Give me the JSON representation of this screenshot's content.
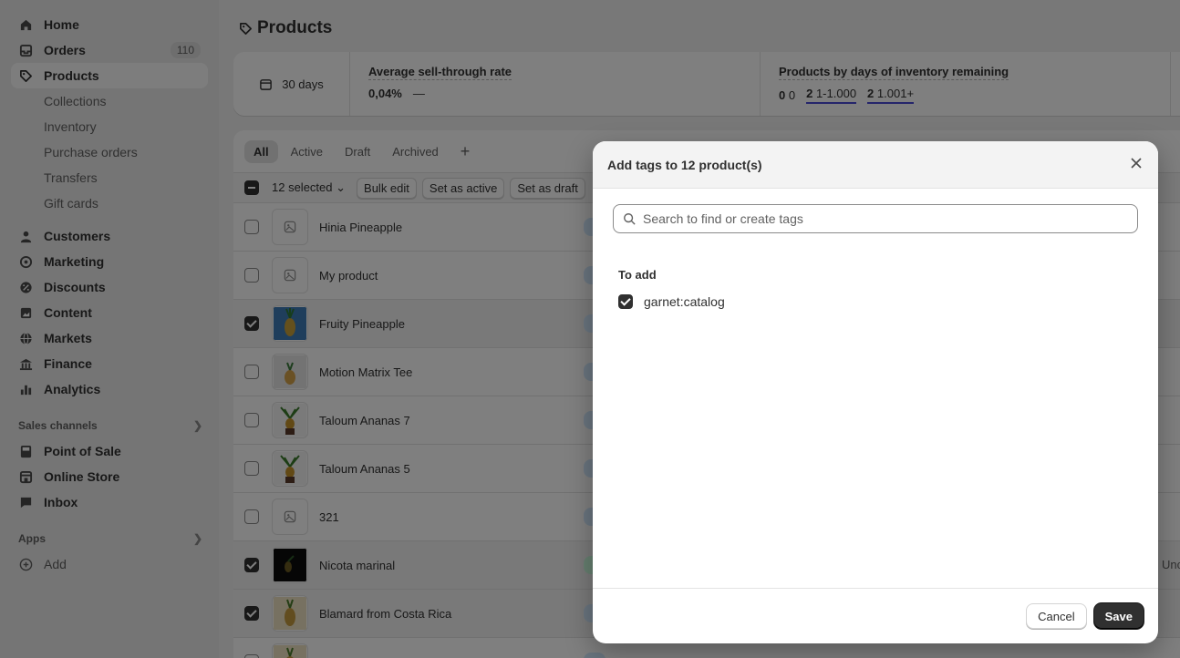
{
  "sidebar": {
    "home": "Home",
    "orders": "Orders",
    "orders_count": "110",
    "products": "Products",
    "sub": [
      "Collections",
      "Inventory",
      "Purchase orders",
      "Transfers",
      "Gift cards"
    ],
    "customers": "Customers",
    "marketing": "Marketing",
    "discounts": "Discounts",
    "content": "Content",
    "markets": "Markets",
    "finance": "Finance",
    "analytics": "Analytics",
    "sales_channels": "Sales channels",
    "pos": "Point of Sale",
    "online_store": "Online Store",
    "inbox": "Inbox",
    "apps": "Apps",
    "add": "Add"
  },
  "page": {
    "title": "Products",
    "period": "30 days",
    "stat1_label": "Average sell-through rate",
    "stat1_value": "0,04%",
    "stat1_dash": "—",
    "stat2_label": "Products by days of inventory remaining",
    "stat2_a_num": "0",
    "stat2_a_lbl": "0",
    "stat2_b_num": "2",
    "stat2_b_lbl": "1-1.000",
    "stat2_c_num": "2",
    "stat2_c_lbl": "1.001+"
  },
  "tabs": [
    "All",
    "Active",
    "Draft",
    "Archived",
    "+"
  ],
  "bulk": {
    "selected": "12 selected",
    "bulk_edit": "Bulk edit",
    "set_active": "Set as active",
    "set_draft": "Set as draft"
  },
  "products": [
    {
      "name": "Hinia Pineapple",
      "checked": false,
      "thumb": "placeholder",
      "status": "blue"
    },
    {
      "name": "My product",
      "checked": false,
      "thumb": "placeholder",
      "status": "blue"
    },
    {
      "name": "Fruity Pineapple",
      "checked": true,
      "thumb": "pine-blue",
      "status": "blue"
    },
    {
      "name": "Motion Matrix Tee",
      "checked": false,
      "thumb": "pine-white",
      "status": "blue"
    },
    {
      "name": "Taloum Ananas 7",
      "checked": false,
      "thumb": "pine-plant",
      "status": "blue"
    },
    {
      "name": "Taloum Ananas 5",
      "checked": false,
      "thumb": "pine-plant",
      "status": "blue"
    },
    {
      "name": "321",
      "checked": false,
      "thumb": "placeholder",
      "status": "blue"
    },
    {
      "name": "Nicota marinal",
      "checked": true,
      "thumb": "pine-dark",
      "status": "green"
    },
    {
      "name": "Blamard from Costa Rica",
      "checked": true,
      "thumb": "pine-cream",
      "status": "blue"
    },
    {
      "name": "",
      "checked": false,
      "thumb": "pine-cream",
      "status": "blue"
    }
  ],
  "partial_right_text": "Unc",
  "modal": {
    "title": "Add tags to 12 product(s)",
    "search_placeholder": "Search to find or create tags",
    "to_add_label": "To add",
    "tag": "garnet:catalog",
    "cancel": "Cancel",
    "save": "Save"
  }
}
